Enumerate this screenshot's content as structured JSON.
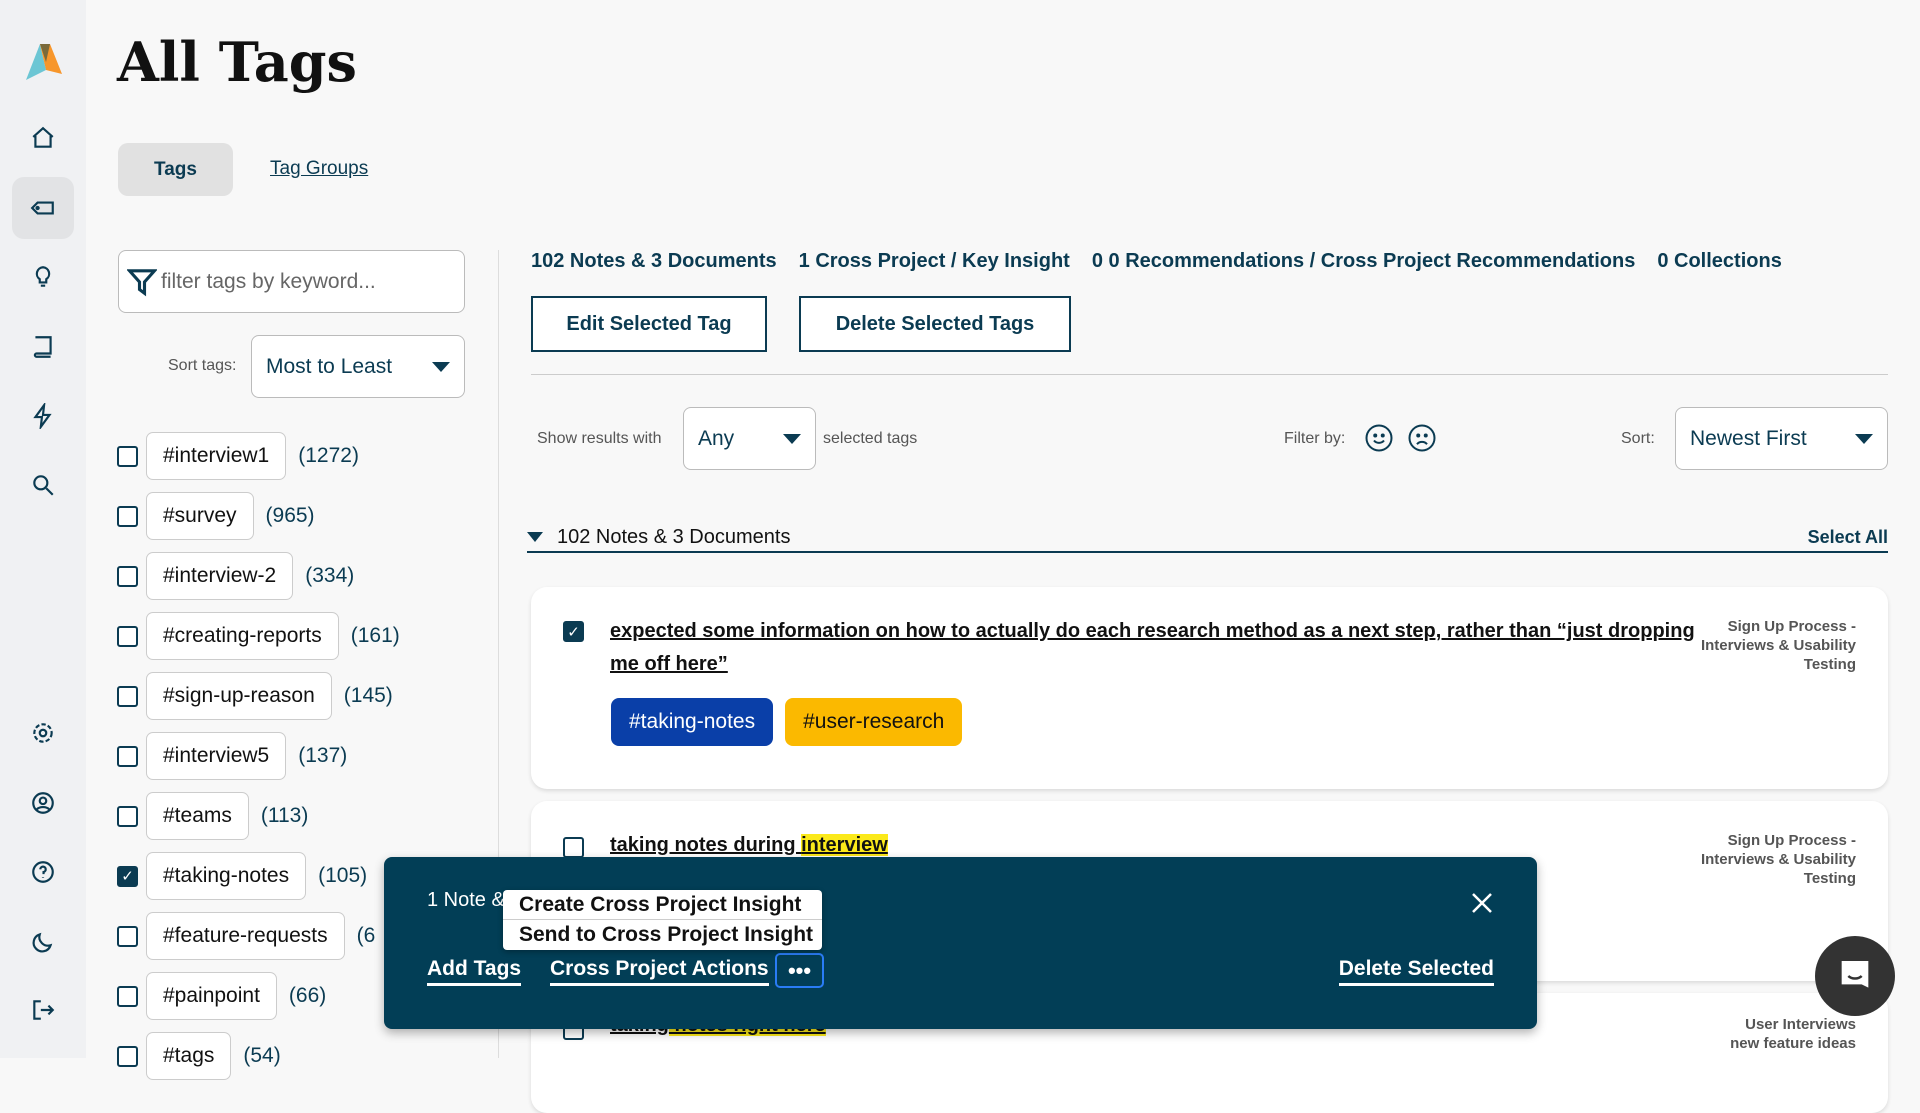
{
  "header": {
    "title": "All Tags",
    "tabs": [
      {
        "label": "Tags",
        "active": true
      },
      {
        "label": "Tag Groups",
        "active": false
      }
    ]
  },
  "sidebar": {
    "items": [
      "home-icon",
      "tag-icon",
      "lightbulb-icon",
      "book-icon",
      "lightning-icon",
      "search-icon",
      "gear-icon",
      "user-circle-icon",
      "help-icon",
      "moon-icon",
      "logout-icon"
    ],
    "active": "tag-icon"
  },
  "filter": {
    "placeholder": "filter tags by keyword..."
  },
  "sort_tags": {
    "label": "Sort tags:",
    "value": "Most to Least"
  },
  "tags": [
    {
      "name": "#interview1",
      "count": "(1272)",
      "checked": false
    },
    {
      "name": "#survey",
      "count": "(965)",
      "checked": false
    },
    {
      "name": "#interview-2",
      "count": "(334)",
      "checked": false
    },
    {
      "name": "#creating-reports",
      "count": "(161)",
      "checked": false
    },
    {
      "name": "#sign-up-reason",
      "count": "(145)",
      "checked": false
    },
    {
      "name": "#interview5",
      "count": "(137)",
      "checked": false
    },
    {
      "name": "#teams",
      "count": "(113)",
      "checked": false
    },
    {
      "name": "#taking-notes",
      "count": "(105)",
      "checked": true
    },
    {
      "name": "#feature-requests",
      "count": "(6",
      "checked": false
    },
    {
      "name": "#painpoint",
      "count": "(66)",
      "checked": false
    },
    {
      "name": "#tags",
      "count": "(54)",
      "checked": false
    }
  ],
  "counts": [
    "102 Notes & 3 Documents",
    "1 Cross Project / Key Insight",
    "0 0 Recommendations / Cross Project Recommendations",
    "0 Collections"
  ],
  "buttons": {
    "edit": "Edit Selected Tag",
    "delete": "Delete Selected Tags"
  },
  "results": {
    "show_label": "Show results with",
    "match": "Any",
    "selected_label": "selected tags",
    "filter_by": "Filter by:",
    "sort_label": "Sort:",
    "sort_value": "Newest First"
  },
  "section": {
    "title": "102 Notes & 3 Documents",
    "select_all": "Select All"
  },
  "notes": [
    {
      "checked": true,
      "text": "expected some information on how to actually do each research method as a next step, rather than “just dropping me off here”",
      "meta": [
        "Sign Up Process -",
        "Interviews & Usability",
        "Testing"
      ],
      "tags": [
        {
          "label": "#taking-notes",
          "color": "#0a3fa8"
        },
        {
          "label": "#user-research",
          "color": "#fbb900"
        }
      ]
    },
    {
      "checked": false,
      "text_plain": "taking notes during ",
      "text_hl": "interview",
      "meta": [
        "Sign Up Process -",
        "Interviews & Usability",
        "Testing"
      ]
    },
    {
      "checked": false,
      "text_plain": "taking",
      "text_hl": " notes right here",
      "meta": [
        "User Interviews",
        "new feature ideas"
      ]
    }
  ],
  "action_bar": {
    "selected": "1 Note & ",
    "add_tags": "Add Tags",
    "cross_project": "Cross Project Actions",
    "delete": "Delete Selected",
    "menu": [
      "Create Cross Project Insight",
      "Send to Cross Project Insight"
    ],
    "bg": "#023e56"
  }
}
